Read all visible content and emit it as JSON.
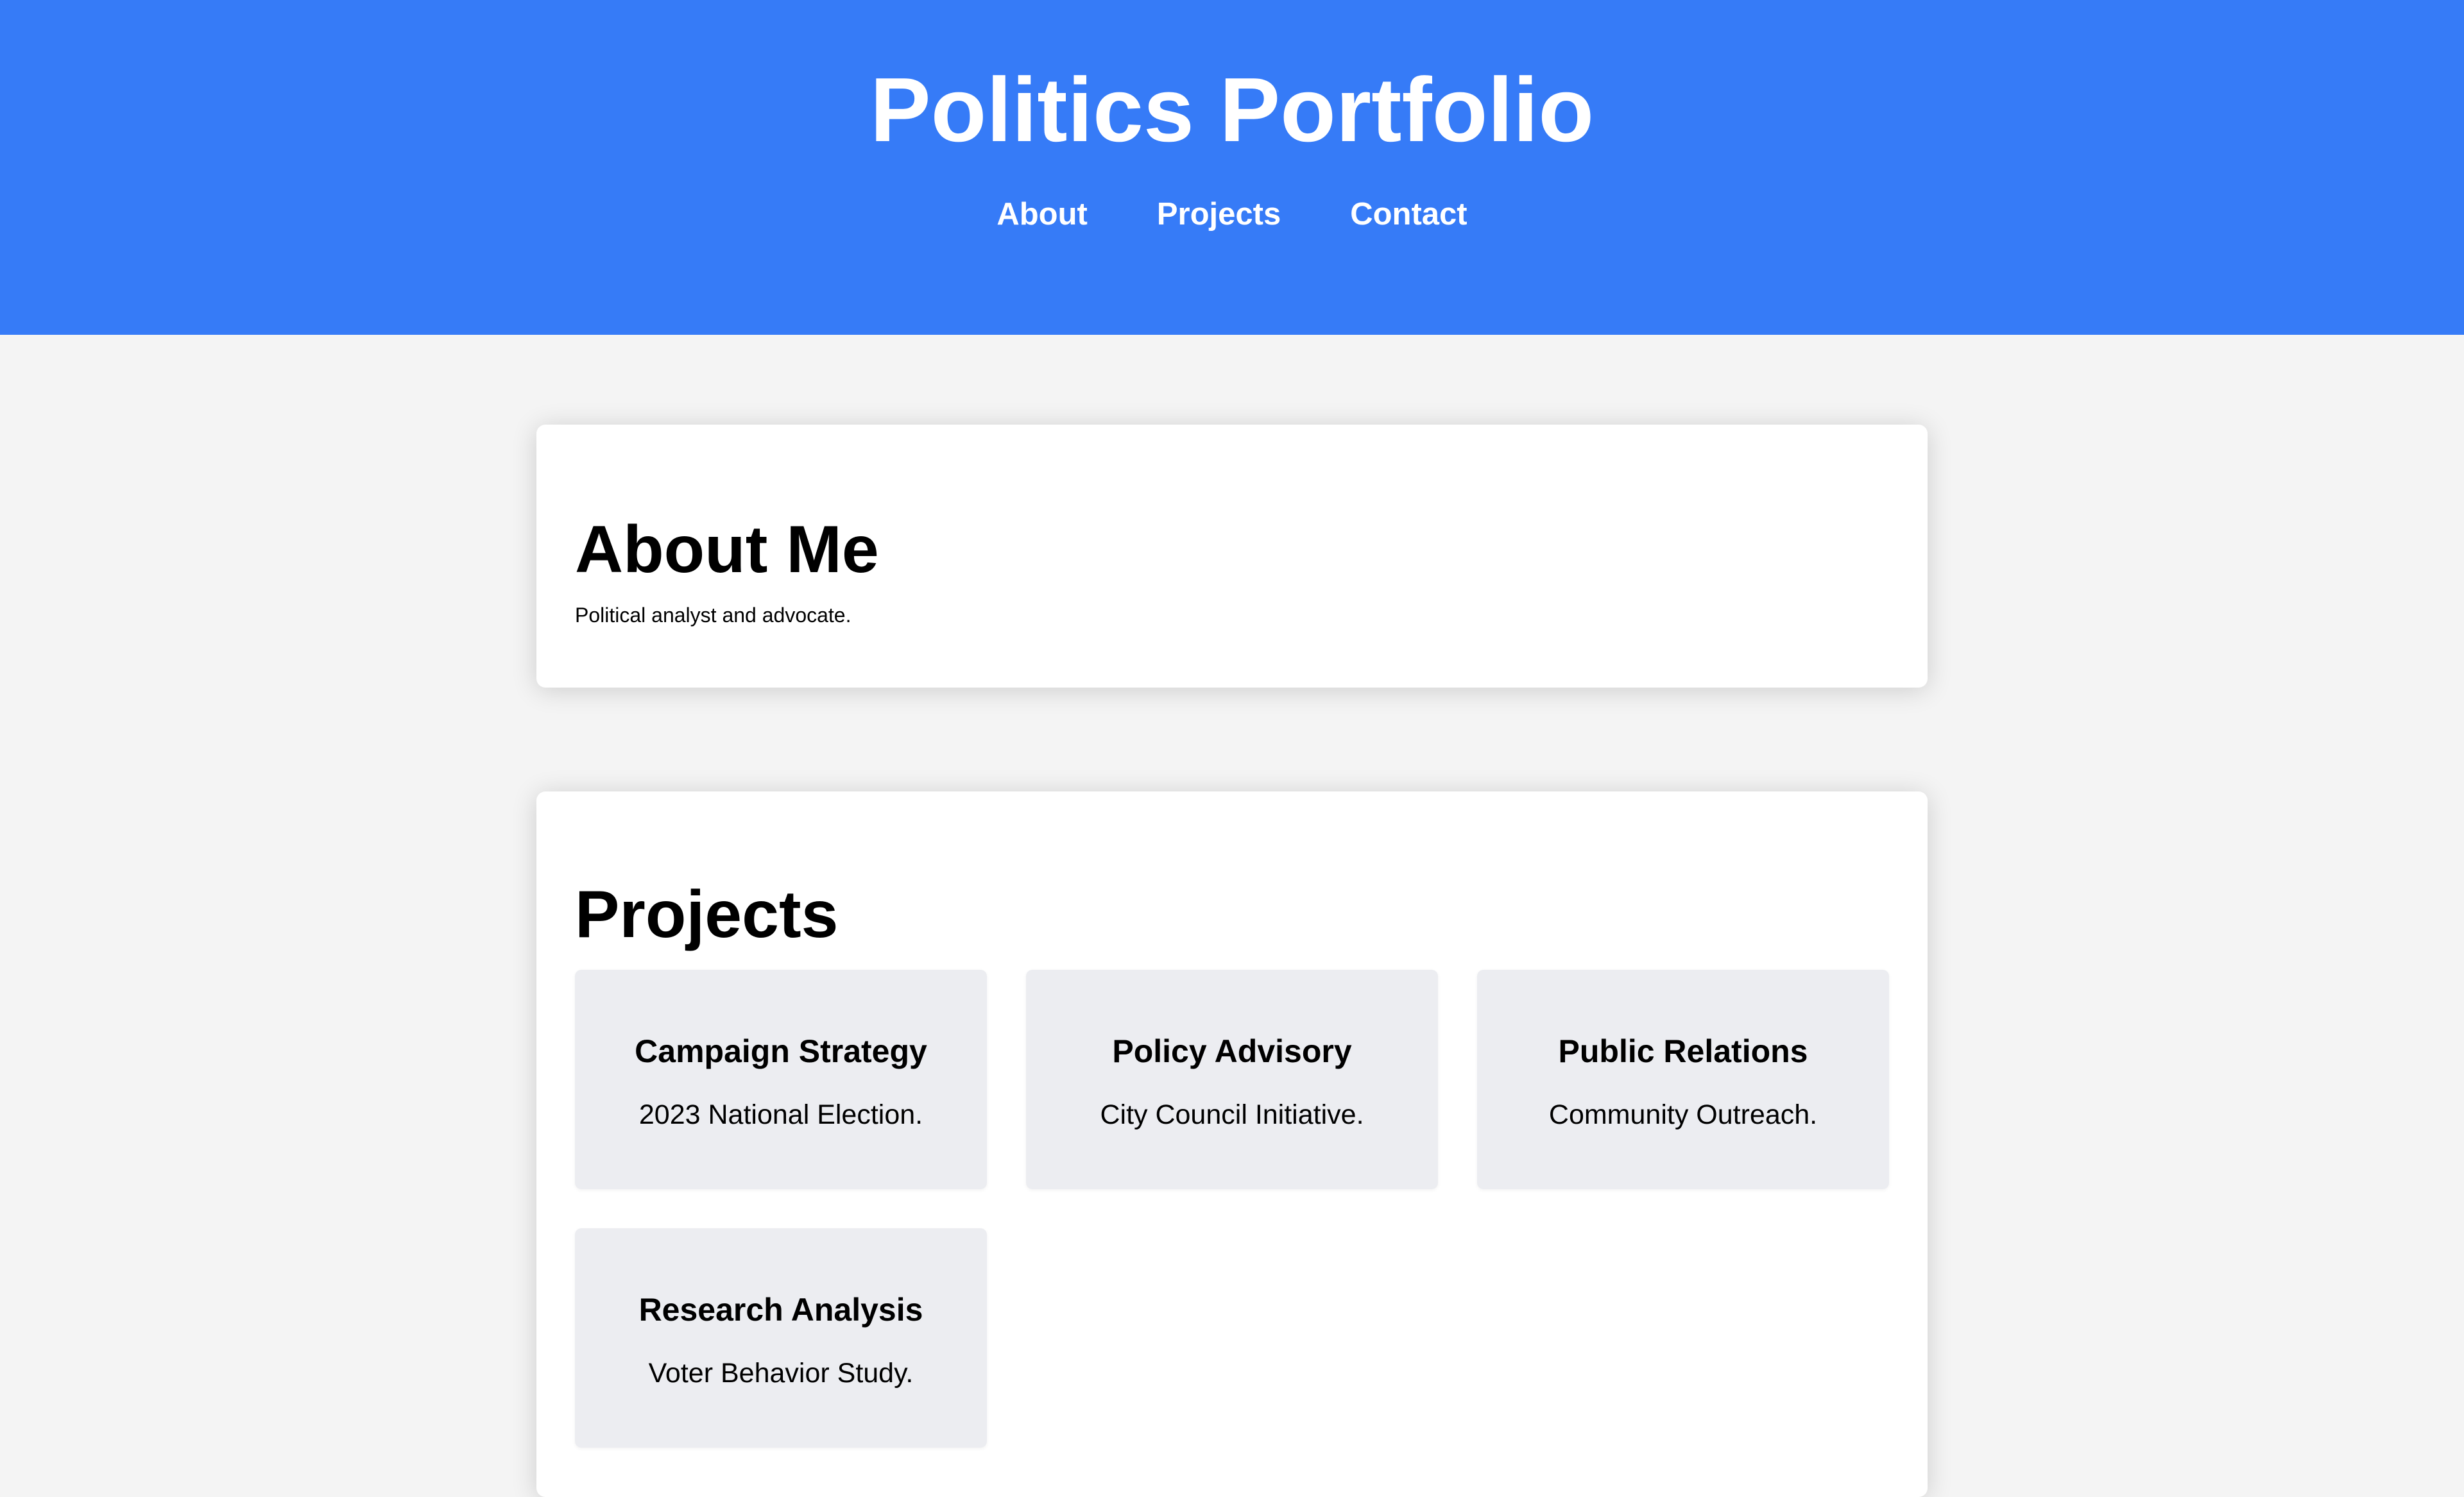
{
  "header": {
    "title": "Politics Portfolio",
    "nav": [
      "About",
      "Projects",
      "Contact"
    ],
    "background_color": "#367bf7"
  },
  "about": {
    "heading": "About Me",
    "text": "Political analyst and advocate."
  },
  "projects": {
    "heading": "Projects",
    "items": [
      {
        "title": "Campaign Strategy",
        "description": "2023 National Election."
      },
      {
        "title": "Policy Advisory",
        "description": "City Council Initiative."
      },
      {
        "title": "Public Relations",
        "description": "Community Outreach."
      },
      {
        "title": "Research Analysis",
        "description": "Voter Behavior Study."
      }
    ]
  }
}
